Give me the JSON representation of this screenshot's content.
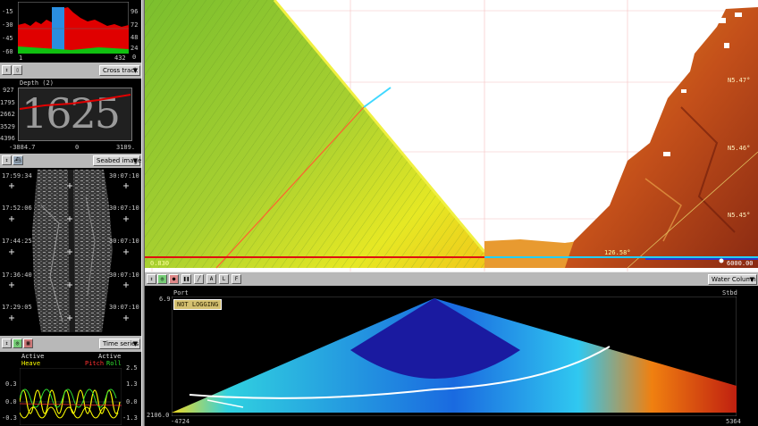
{
  "histogram": {
    "y_left": [
      "-15",
      "-30",
      "-45",
      "-60"
    ],
    "y_right": [
      "96",
      "72",
      "48",
      "24",
      "0"
    ],
    "x_left": "1",
    "x_right": "432"
  },
  "cross_track": {
    "dropdown": "Cross track",
    "title": "Depth (2)",
    "depth_value": "1625",
    "y_labels": [
      "927",
      "1795",
      "2662",
      "3529",
      "4396"
    ],
    "x_labels": [
      "-3884.7",
      "0",
      "3189."
    ]
  },
  "seabed": {
    "dropdown": "Seabed image",
    "left_times": [
      "17:59:34",
      "17:52:06",
      "17:44:25",
      "17:36:40",
      "17:29:05"
    ],
    "right_times": [
      "30:07:10",
      "30:07:10",
      "30:07:10",
      "30:07:10",
      "30:07:10"
    ]
  },
  "time_series": {
    "dropdown": "Time series",
    "active_left": "Active",
    "active_right": "Active",
    "heave": "Heave",
    "pitch": "Pitch",
    "roll": "Roll",
    "y_left": [
      "0.3",
      "0.0",
      "-0.3"
    ],
    "y_right": [
      "2.5",
      "1.3",
      "0.0",
      "-1.3"
    ]
  },
  "map": {
    "lat_labels": [
      "N5.47°",
      "N5.46°",
      "N5.45°"
    ],
    "heading": "126.58°",
    "depth_end": "6000.00",
    "left_value": "0.830"
  },
  "water_column": {
    "dropdown": "Water Column",
    "port": "Port",
    "stbd": "Stbd",
    "logging": "NOT LOGGING",
    "y_top": "6.9",
    "y_bottom": "2106.0",
    "x_left": "-4724",
    "x_right": "5364"
  },
  "colors": {
    "accent_red": "#ff0000",
    "accent_yellow": "#ffff00",
    "accent_cyan": "#00e5ff"
  }
}
